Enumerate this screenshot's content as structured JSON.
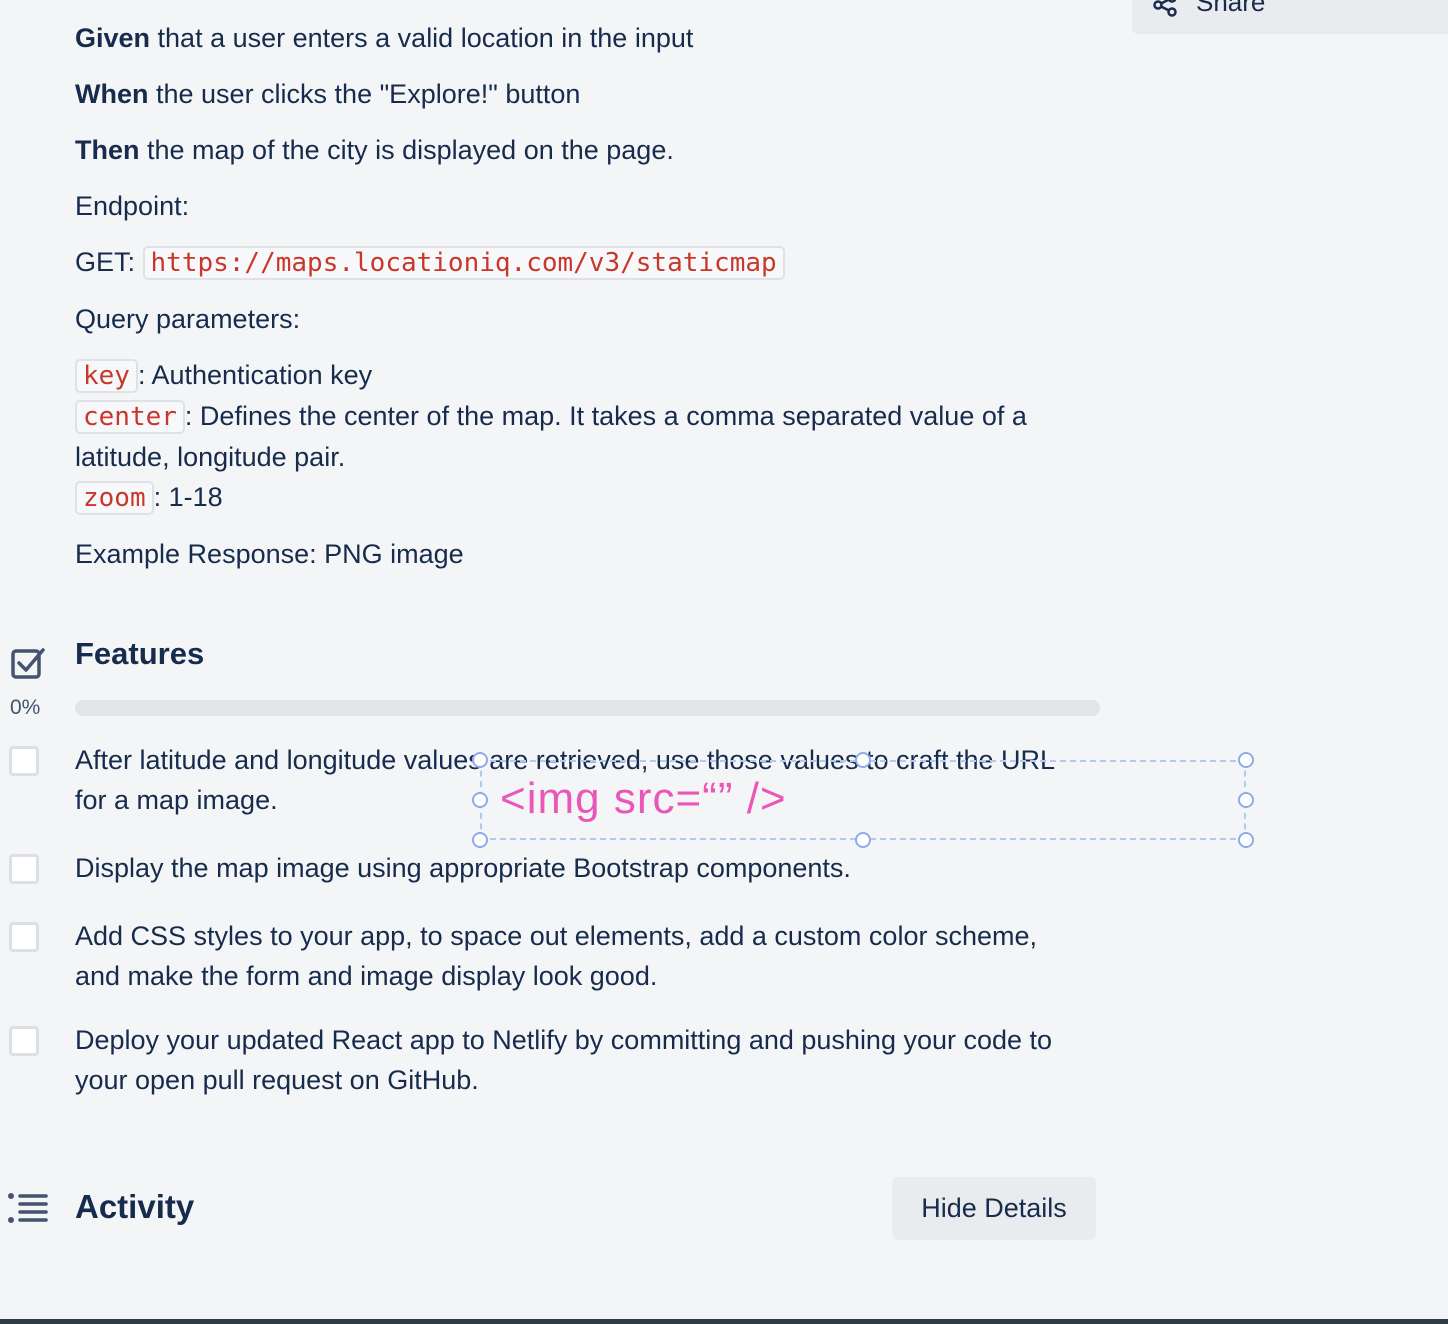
{
  "header": {
    "share_label": "Share"
  },
  "description": {
    "given_keyword": "Given",
    "given_text": " that a user enters a valid location in the input",
    "when_keyword": "When",
    "when_text": " the user clicks the \"Explore!\" button",
    "then_keyword": "Then",
    "then_text": " the map of the city is displayed on the page.",
    "endpoint_label": "Endpoint:",
    "get_label": "GET: ",
    "endpoint_url": "https://maps.locationiq.com/v3/staticmap",
    "query_label": "Query parameters:",
    "params": [
      {
        "name": "key",
        "desc": ": Authentication key"
      },
      {
        "name": "center",
        "desc": ": Defines the center of the map. It takes a comma separated value of a latitude, longitude pair."
      },
      {
        "name": "zoom",
        "desc": ": 1-18"
      }
    ],
    "example_response": "Example Response: PNG image"
  },
  "features": {
    "title": "Features",
    "progress_label": "0%",
    "progress_fraction": 0,
    "items": [
      {
        "text": "After latitude and longitude values are retrieved, use those values to craft the URL for a map image.",
        "checked": false
      },
      {
        "text": "Display the map image using appropriate Bootstrap components.",
        "checked": false
      },
      {
        "text": "Add CSS styles to your app, to space out elements, add a custom color scheme, and make the form and image display look good.",
        "checked": false
      },
      {
        "text": "Deploy your updated React app to Netlify by committing and pushing your code to your open pull request on GitHub.",
        "checked": false
      }
    ]
  },
  "overlay": {
    "text": "<img src=“” />"
  },
  "activity": {
    "title": "Activity",
    "hide_details_label": "Hide Details"
  },
  "colors": {
    "code_text": "#c9372c",
    "overlay_text": "#e957b8",
    "progress_track": "#e2e4e9"
  }
}
